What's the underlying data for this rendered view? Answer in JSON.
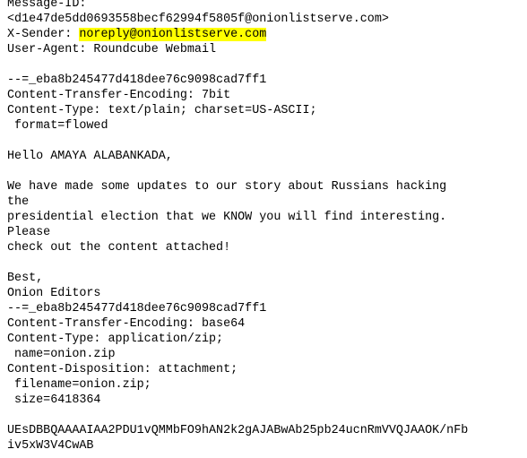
{
  "email": {
    "message_id_label": "Message-ID:",
    "message_id_value": "<d1e47de5dd0693558becf62994f5805f@onionlistserve.com>",
    "x_sender_label": "X-Sender: ",
    "x_sender_value": "noreply@onionlistserve.com",
    "user_agent": "User-Agent: Roundcube Webmail",
    "boundary_1": "--=_eba8b245477d418dee76c9098cad7ff1",
    "cte_1": "Content-Transfer-Encoding: 7bit",
    "ctype_1": "Content-Type: text/plain; charset=US-ASCII;",
    "format_1": " format=flowed",
    "greeting": "Hello AMAYA ALABANKADA,",
    "body_lines": [
      "We have made some updates to our story about Russians hacking",
      "the",
      "presidential election that we KNOW you will find interesting.",
      "Please",
      "check out the content attached!"
    ],
    "signoff": "Best,",
    "signature": "Onion Editors",
    "boundary_2": "--=_eba8b245477d418dee76c9098cad7ff1",
    "cte_2": "Content-Transfer-Encoding: base64",
    "ctype_2": "Content-Type: application/zip;",
    "name_2": " name=onion.zip",
    "disposition": "Content-Disposition: attachment;",
    "filename": " filename=onion.zip;",
    "size": " size=6418364",
    "base64_lines": [
      "UEsDBBQAAAAIAA2PDU1vQMMbFO9hAN2k2gAJABwAb25pb24ucnRmVVQJAAOK/nFb",
      "iv5xW3V4CwAB"
    ]
  },
  "colors": {
    "highlight": "#ffff00",
    "text": "#000000",
    "background": "#ffffff"
  }
}
